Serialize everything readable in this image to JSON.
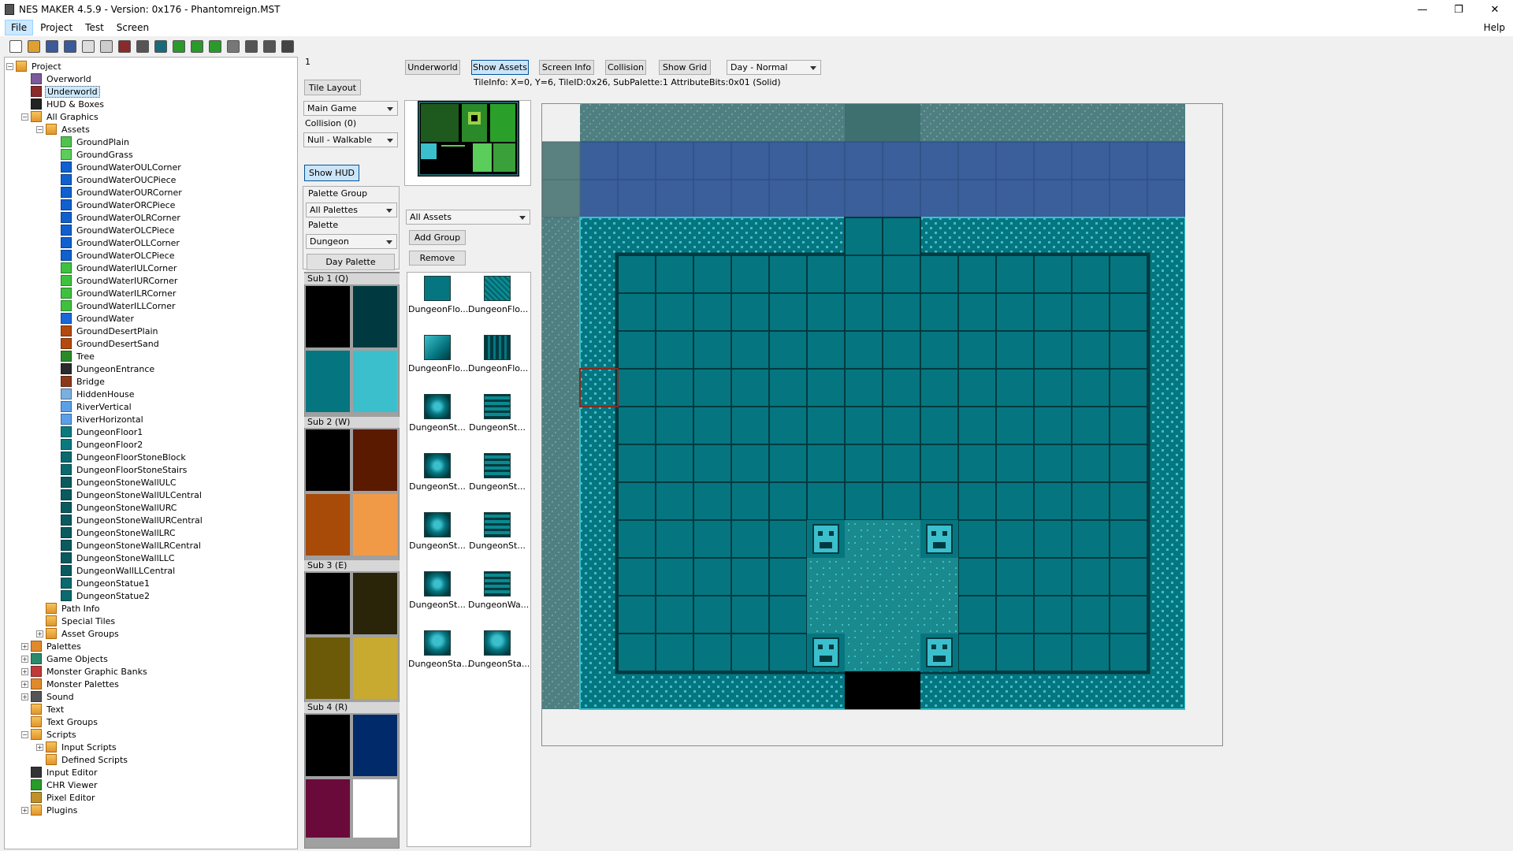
{
  "window": {
    "title": "NES MAKER 4.5.9 - Version: 0x176 - Phantomreign.MST",
    "minimize": "—",
    "maximize": "❐",
    "close": "✕"
  },
  "menu": {
    "file": "File",
    "project": "Project",
    "test": "Test",
    "screen": "Screen",
    "help": "Help"
  },
  "toolbar_icons": [
    "new-icon",
    "open-icon",
    "save-icon",
    "save-all-icon",
    "export-icon",
    "import-icon",
    "build-icon",
    "settings-icon",
    "run-icon",
    "arrow-left-icon",
    "arrow-right-icon",
    "arrow-up-icon",
    "camera-icon",
    "monitor-icon",
    "printer-icon",
    "floppy-icon"
  ],
  "tree": [
    {
      "label": "Project",
      "depth": 0,
      "expander": "−",
      "icon": "folder"
    },
    {
      "label": "Overworld",
      "depth": 1,
      "icon": "map",
      "color": "#7a5a9a"
    },
    {
      "label": "Underworld",
      "depth": 1,
      "icon": "map",
      "color": "#8a2a2a",
      "selected": true
    },
    {
      "label": "HUD & Boxes",
      "depth": 1,
      "icon": "hud",
      "color": "#222"
    },
    {
      "label": "All Graphics",
      "depth": 1,
      "expander": "−",
      "icon": "folder"
    },
    {
      "label": "Assets",
      "depth": 2,
      "expander": "−",
      "icon": "folder"
    },
    {
      "label": "GroundPlain",
      "depth": 3,
      "color": "#4fc24f"
    },
    {
      "label": "GroundGrass",
      "depth": 3,
      "color": "#5acd5a"
    },
    {
      "label": "GroundWaterOULCorner",
      "depth": 3,
      "color": "#1060d0"
    },
    {
      "label": "GroundWaterOUCPiece",
      "depth": 3,
      "color": "#1060d0"
    },
    {
      "label": "GroundWaterOURCorner",
      "depth": 3,
      "color": "#1060d0"
    },
    {
      "label": "GroundWaterORCPiece",
      "depth": 3,
      "color": "#1060d0"
    },
    {
      "label": "GroundWaterOLRCorner",
      "depth": 3,
      "color": "#1060d0"
    },
    {
      "label": "GroundWaterOLCPiece",
      "depth": 3,
      "color": "#1060d0"
    },
    {
      "label": "GroundWaterOLLCorner",
      "depth": 3,
      "color": "#1060d0"
    },
    {
      "label": "GroundWaterOLCPiece",
      "depth": 3,
      "color": "#1060d0"
    },
    {
      "label": "GroundWaterIULCorner",
      "depth": 3,
      "color": "#3ec23e"
    },
    {
      "label": "GroundWaterIURCorner",
      "depth": 3,
      "color": "#3ec23e"
    },
    {
      "label": "GroundWaterILRCorner",
      "depth": 3,
      "color": "#3ec23e"
    },
    {
      "label": "GroundWaterILLCorner",
      "depth": 3,
      "color": "#3ec23e"
    },
    {
      "label": "GroundWater",
      "depth": 3,
      "color": "#1868d8"
    },
    {
      "label": "GroundDesertPlain",
      "depth": 3,
      "color": "#b34a10"
    },
    {
      "label": "GroundDesertSand",
      "depth": 3,
      "color": "#b34a10"
    },
    {
      "label": "Tree",
      "depth": 3,
      "color": "#2a8a2a"
    },
    {
      "label": "DungeonEntrance",
      "depth": 3,
      "color": "#2a2a2a"
    },
    {
      "label": "Bridge",
      "depth": 3,
      "color": "#8a3a1a"
    },
    {
      "label": "HiddenHouse",
      "depth": 3,
      "color": "#7ab0e0"
    },
    {
      "label": "RiverVertical",
      "depth": 3,
      "color": "#5aa0e8"
    },
    {
      "label": "RiverHorizontal",
      "depth": 3,
      "color": "#5aa0e8"
    },
    {
      "label": "DungeonFloor1",
      "depth": 3,
      "color": "#0a7a80"
    },
    {
      "label": "DungeonFloor2",
      "depth": 3,
      "color": "#0a7a80"
    },
    {
      "label": "DungeonFloorStoneBlock",
      "depth": 3,
      "color": "#0a6a70"
    },
    {
      "label": "DungeonFloorStoneStairs",
      "depth": 3,
      "color": "#0a6a70"
    },
    {
      "label": "DungeonStoneWallULC",
      "depth": 3,
      "color": "#0a5a60"
    },
    {
      "label": "DungeonStoneWallULCentral",
      "depth": 3,
      "color": "#0a5a60"
    },
    {
      "label": "DungeonStoneWallURC",
      "depth": 3,
      "color": "#0a5a60"
    },
    {
      "label": "DungeonStoneWallURCentral",
      "depth": 3,
      "color": "#0a5a60"
    },
    {
      "label": "DungeonStoneWallLRC",
      "depth": 3,
      "color": "#0a5a60"
    },
    {
      "label": "DungeonStoneWallLRCentral",
      "depth": 3,
      "color": "#0a5a60"
    },
    {
      "label": "DungeonStoneWallLLC",
      "depth": 3,
      "color": "#0a5a60"
    },
    {
      "label": "DungeonWallLLCentral",
      "depth": 3,
      "color": "#0a5a60"
    },
    {
      "label": "DungeonStatue1",
      "depth": 3,
      "color": "#0a6a70"
    },
    {
      "label": "DungeonStatue2",
      "depth": 3,
      "color": "#0a6a70"
    },
    {
      "label": "Path Info",
      "depth": 2,
      "icon": "folder"
    },
    {
      "label": "Special Tiles",
      "depth": 2,
      "icon": "folder"
    },
    {
      "label": "Asset Groups",
      "depth": 2,
      "expander": "+",
      "icon": "folder"
    },
    {
      "label": "Palettes",
      "depth": 1,
      "expander": "+",
      "icon": "palette",
      "color": "#e08a2a"
    },
    {
      "label": "Game Objects",
      "depth": 1,
      "expander": "+",
      "icon": "gameobj",
      "color": "#2a8a6a"
    },
    {
      "label": "Monster Graphic Banks",
      "depth": 1,
      "expander": "+",
      "icon": "monster",
      "color": "#c03a3a"
    },
    {
      "label": "Monster Palettes",
      "depth": 1,
      "expander": "+",
      "icon": "palette",
      "color": "#e08a2a"
    },
    {
      "label": "Sound",
      "depth": 1,
      "expander": "+",
      "icon": "sound",
      "color": "#555"
    },
    {
      "label": "Text",
      "depth": 1,
      "icon": "folder"
    },
    {
      "label": "Text Groups",
      "depth": 1,
      "icon": "folder"
    },
    {
      "label": "Scripts",
      "depth": 1,
      "expander": "−",
      "icon": "folder"
    },
    {
      "label": "Input Scripts",
      "depth": 2,
      "expander": "+",
      "icon": "folder"
    },
    {
      "label": "Defined Scripts",
      "depth": 2,
      "icon": "folder"
    },
    {
      "label": "Input Editor",
      "depth": 1,
      "icon": "input",
      "color": "#333"
    },
    {
      "label": "CHR Viewer",
      "depth": 1,
      "icon": "chr",
      "color": "#2a9a2a"
    },
    {
      "label": "Pixel Editor",
      "depth": 1,
      "icon": "pencil",
      "color": "#c0902a"
    },
    {
      "label": "Plugins",
      "depth": 1,
      "expander": "+",
      "icon": "folder"
    }
  ],
  "panel": {
    "screen_index": "1",
    "tile_layout": "Tile Layout",
    "main_game": "Main Game",
    "collision_label": "Collision (0)",
    "collision_value": "Null - Walkable",
    "show_hud": "Show HUD",
    "palette_group_label": "Palette Group",
    "palette_group_value": "All Palettes",
    "palette_label": "Palette",
    "palette_value": "Dungeon",
    "day_palette": "Day Palette"
  },
  "subpalettes": [
    {
      "label": "Sub 1 (Q)",
      "colors": [
        "#000000",
        "#003a40",
        "#057680",
        "#3cbfcc"
      ]
    },
    {
      "label": "Sub 2 (W)",
      "colors": [
        "#000000",
        "#5a1a00",
        "#a84a08",
        "#f09a48"
      ]
    },
    {
      "label": "Sub 3 (E)",
      "colors": [
        "#000000",
        "#2a2408",
        "#6c5a08",
        "#c8aa30"
      ]
    },
    {
      "label": "Sub 4 (R)",
      "colors": [
        "#000000",
        "#002a6a",
        "#6a0a3a",
        "#ffffff"
      ]
    }
  ],
  "top_buttons": {
    "underworld": "Underworld",
    "show_assets": "Show Assets",
    "screen_info": "Screen Info",
    "collision": "Collision",
    "show_grid": "Show Grid",
    "time_of_day": "Day - Normal"
  },
  "tile_info": "TileInfo: X=0, Y=6, TileID:0x26, SubPalette:1 AttributeBits:0x01 (Solid)",
  "assets": {
    "filter": "All Assets",
    "add_group": "Add Group",
    "remove": "Remove",
    "items": [
      {
        "name": "DungeonFlo...",
        "kind": "floor"
      },
      {
        "name": "DungeonFlo...",
        "kind": "floor2"
      },
      {
        "name": "DungeonFlo...",
        "kind": "block"
      },
      {
        "name": "DungeonFlo...",
        "kind": "stairs"
      },
      {
        "name": "DungeonSt...",
        "kind": "stone"
      },
      {
        "name": "DungeonSt...",
        "kind": "stone2"
      },
      {
        "name": "DungeonSt...",
        "kind": "stone"
      },
      {
        "name": "DungeonSt...",
        "kind": "stone2"
      },
      {
        "name": "DungeonSt...",
        "kind": "stone"
      },
      {
        "name": "DungeonSt...",
        "kind": "stone2"
      },
      {
        "name": "DungeonSt...",
        "kind": "stone"
      },
      {
        "name": "DungeonWa...",
        "kind": "stone2"
      },
      {
        "name": "DungeonSta...",
        "kind": "statue"
      },
      {
        "name": "DungeonSta...",
        "kind": "statue"
      }
    ]
  },
  "colors": {
    "hud_blue": "#3a5f9a",
    "floor": "#057680",
    "floor_line": "#003a40",
    "wall": "#057680",
    "wall_light": "#3cbfcc",
    "sand": "#1a8a8e",
    "black": "#000000",
    "cursor": "#8a2a1a"
  }
}
